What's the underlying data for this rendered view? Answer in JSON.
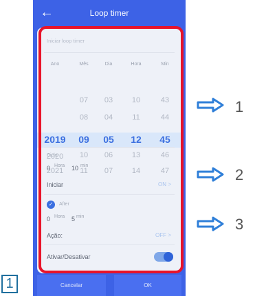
{
  "header": {
    "back_icon": "arrow-left-icon",
    "title": "Loop timer"
  },
  "card": {
    "title_placeholder": "Iniciar loop timer",
    "picker": {
      "columns": [
        "Ano",
        "Mês",
        "Dia",
        "Hora",
        "Min"
      ],
      "rows": [
        [
          "",
          "07",
          "03",
          "10",
          "43"
        ],
        [
          "",
          "08",
          "04",
          "11",
          "44"
        ],
        [
          "2019",
          "09",
          "05",
          "12",
          "45"
        ],
        [
          "2020",
          "10",
          "06",
          "13",
          "46"
        ],
        [
          "2021",
          "11",
          "07",
          "14",
          "47"
        ]
      ],
      "selected_row": 2
    },
    "cycle": {
      "label": "Ciclo",
      "hours": "0",
      "hours_unit": "Hora",
      "minutes": "10",
      "minutes_unit": "min"
    },
    "start": {
      "label": "Iniciar",
      "status": "ON",
      "chevron": ">"
    },
    "after": {
      "label": "After",
      "hours": "0",
      "hours_unit": "Hora",
      "minutes": "5",
      "minutes_unit": "min"
    },
    "action": {
      "label": "Ação:",
      "status": "OFF",
      "chevron": ">"
    },
    "activate": {
      "label": "Ativar/Desativar",
      "enabled": true
    }
  },
  "buttons": {
    "cancel": "Cancelar",
    "ok": "OK"
  },
  "annotations": {
    "callouts": [
      "1",
      "2",
      "3"
    ],
    "badge": "1",
    "highlight_color": "#e8132a",
    "arrow_color": "#2f7fd8"
  },
  "colors": {
    "primary": "#3d62e6",
    "selected": "#3b6fe0",
    "card": "#eef1f8"
  }
}
